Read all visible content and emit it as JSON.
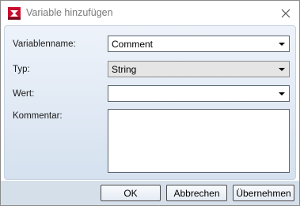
{
  "window": {
    "title": "Variable hinzufügen"
  },
  "form": {
    "name_label": "Variablenname:",
    "name_value": "Comment",
    "type_label": "Typ:",
    "type_value": "String",
    "value_label": "Wert:",
    "value_value": "",
    "comment_label": "Kommentar:",
    "comment_value": ""
  },
  "buttons": {
    "ok": "OK",
    "cancel": "Abbrechen",
    "apply": "Übernehmen"
  },
  "icons": {
    "app": "app-logo-icon",
    "close": "close-icon",
    "dropdown": "chevron-down-icon"
  }
}
